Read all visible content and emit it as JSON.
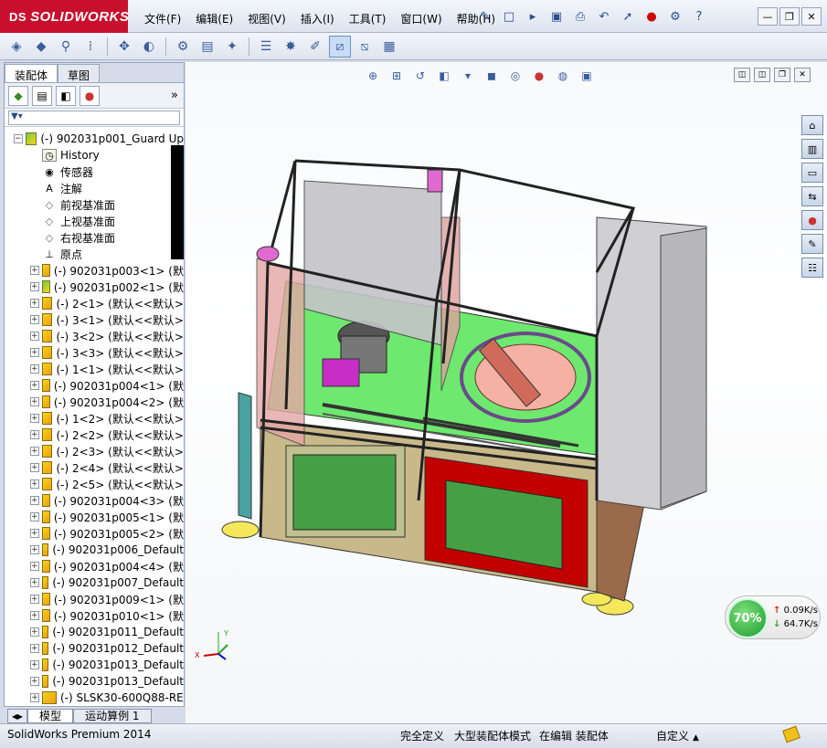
{
  "app": {
    "logo": "SOLIDWORKS",
    "logo_prefix": "DS"
  },
  "menu": [
    "文件(F)",
    "编辑(E)",
    "视图(V)",
    "插入(I)",
    "工具(T)",
    "窗口(W)",
    "帮助(H)"
  ],
  "left_panel": {
    "tabs": [
      "装配体",
      "草图"
    ],
    "selected_tab": 0,
    "expand_more": "»",
    "tree": [
      {
        "indent": 0,
        "exp": "−",
        "icon": "asm",
        "label": "(-) 902031p001_Guard Up"
      },
      {
        "indent": 1,
        "exp": "",
        "icon": "hist",
        "label": "History"
      },
      {
        "indent": 1,
        "exp": "",
        "icon": "sensor",
        "label": "传感器"
      },
      {
        "indent": 1,
        "exp": "",
        "icon": "note",
        "label": "注解"
      },
      {
        "indent": 1,
        "exp": "",
        "icon": "plane",
        "label": "前视基准面"
      },
      {
        "indent": 1,
        "exp": "",
        "icon": "plane",
        "label": "上视基准面"
      },
      {
        "indent": 1,
        "exp": "",
        "icon": "plane",
        "label": "右视基准面"
      },
      {
        "indent": 1,
        "exp": "",
        "icon": "origin",
        "label": "原点"
      },
      {
        "indent": 1,
        "exp": "+",
        "icon": "part",
        "label": "(-) 902031p003<1> (默"
      },
      {
        "indent": 1,
        "exp": "+",
        "icon": "asm",
        "label": "(-) 902031p002<1> (默"
      },
      {
        "indent": 1,
        "exp": "+",
        "icon": "part",
        "label": "(-) 2<1> (默认<<默认>"
      },
      {
        "indent": 1,
        "exp": "+",
        "icon": "part",
        "label": "(-) 3<1> (默认<<默认>"
      },
      {
        "indent": 1,
        "exp": "+",
        "icon": "part",
        "label": "(-) 3<2> (默认<<默认>"
      },
      {
        "indent": 1,
        "exp": "+",
        "icon": "part",
        "label": "(-) 3<3> (默认<<默认>"
      },
      {
        "indent": 1,
        "exp": "+",
        "icon": "part",
        "label": "(-) 1<1> (默认<<默认>"
      },
      {
        "indent": 1,
        "exp": "+",
        "icon": "part",
        "label": "(-) 902031p004<1> (默"
      },
      {
        "indent": 1,
        "exp": "+",
        "icon": "part",
        "label": "(-) 902031p004<2> (默"
      },
      {
        "indent": 1,
        "exp": "+",
        "icon": "part",
        "label": "(-) 1<2> (默认<<默认>"
      },
      {
        "indent": 1,
        "exp": "+",
        "icon": "part",
        "label": "(-) 2<2> (默认<<默认>"
      },
      {
        "indent": 1,
        "exp": "+",
        "icon": "part",
        "label": "(-) 2<3> (默认<<默认>"
      },
      {
        "indent": 1,
        "exp": "+",
        "icon": "part",
        "label": "(-) 2<4> (默认<<默认>"
      },
      {
        "indent": 1,
        "exp": "+",
        "icon": "part",
        "label": "(-) 2<5> (默认<<默认>"
      },
      {
        "indent": 1,
        "exp": "+",
        "icon": "part",
        "label": "(-) 902031p004<3> (默"
      },
      {
        "indent": 1,
        "exp": "+",
        "icon": "part",
        "label": "(-) 902031p005<1> (默"
      },
      {
        "indent": 1,
        "exp": "+",
        "icon": "part",
        "label": "(-) 902031p005<2> (默"
      },
      {
        "indent": 1,
        "exp": "+",
        "icon": "part",
        "label": "(-) 902031p006_Default"
      },
      {
        "indent": 1,
        "exp": "+",
        "icon": "part",
        "label": "(-) 902031p004<4> (默"
      },
      {
        "indent": 1,
        "exp": "+",
        "icon": "part",
        "label": "(-) 902031p007_Default"
      },
      {
        "indent": 1,
        "exp": "+",
        "icon": "part",
        "label": "(-) 902031p009<1> (默"
      },
      {
        "indent": 1,
        "exp": "+",
        "icon": "part",
        "label": "(-) 902031p010<1> (默"
      },
      {
        "indent": 1,
        "exp": "+",
        "icon": "part",
        "label": "(-) 902031p011_Default"
      },
      {
        "indent": 1,
        "exp": "+",
        "icon": "part",
        "label": "(-) 902031p012_Default"
      },
      {
        "indent": 1,
        "exp": "+",
        "icon": "part",
        "label": "(-) 902031p013_Default"
      },
      {
        "indent": 1,
        "exp": "+",
        "icon": "part",
        "label": "(-) 902031p013_Default"
      },
      {
        "indent": 1,
        "exp": "+",
        "icon": "part",
        "label": "(-) SLSK30-600Q88-RE"
      }
    ]
  },
  "bottom_tabs": [
    "模型",
    "运动算例 1"
  ],
  "network": {
    "percent": "70%",
    "up": "0.09K/s",
    "down": "64.7K/s"
  },
  "status": {
    "app": "SolidWorks Premium 2014",
    "s1": "完全定义",
    "s2": "大型装配体模式",
    "s3": "在编辑 装配体",
    "s4": "自定义"
  },
  "colors": {
    "accent_red": "#c8102e",
    "green_panel": "#5fe05f",
    "door_red": "#c20000"
  }
}
